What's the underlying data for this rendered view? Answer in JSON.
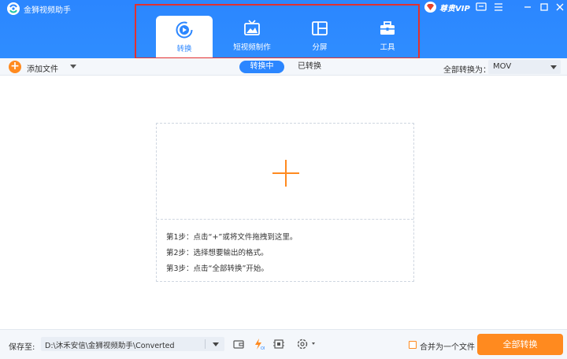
{
  "app": {
    "title": "金狮视频助手"
  },
  "tabs": [
    {
      "label": "转换",
      "icon": "convert-icon",
      "active": true
    },
    {
      "label": "短视频制作",
      "icon": "short-video-icon",
      "active": false
    },
    {
      "label": "分屏",
      "icon": "split-screen-icon",
      "active": false
    },
    {
      "label": "工具",
      "icon": "toolbox-icon",
      "active": false
    }
  ],
  "vip": {
    "label": "尊贵VIP"
  },
  "window_controls": {
    "minimize": "—",
    "maximize": "☐",
    "close": "✕"
  },
  "toolbar": {
    "add_file": "添加文件",
    "seg_converting": "转换中",
    "seg_converted": "已转换",
    "convert_all_to": "全部转换为：",
    "format": "MOV"
  },
  "dropzone": {
    "steps": [
      "第1步：点击“+”或将文件拖拽到这里。",
      "第2步：选择想要输出的格式。",
      "第3步：点击“全部转换”开始。"
    ]
  },
  "footer": {
    "save_to": "保存至:",
    "path": "D:\\沐禾安信\\金狮视频助手\\Converted",
    "merge_label": "合并为一个文件",
    "convert_all_button": "全部转换"
  },
  "colors": {
    "primary": "#2b86ff",
    "accent": "#ff8a1f",
    "highlight_border": "#e23030"
  }
}
